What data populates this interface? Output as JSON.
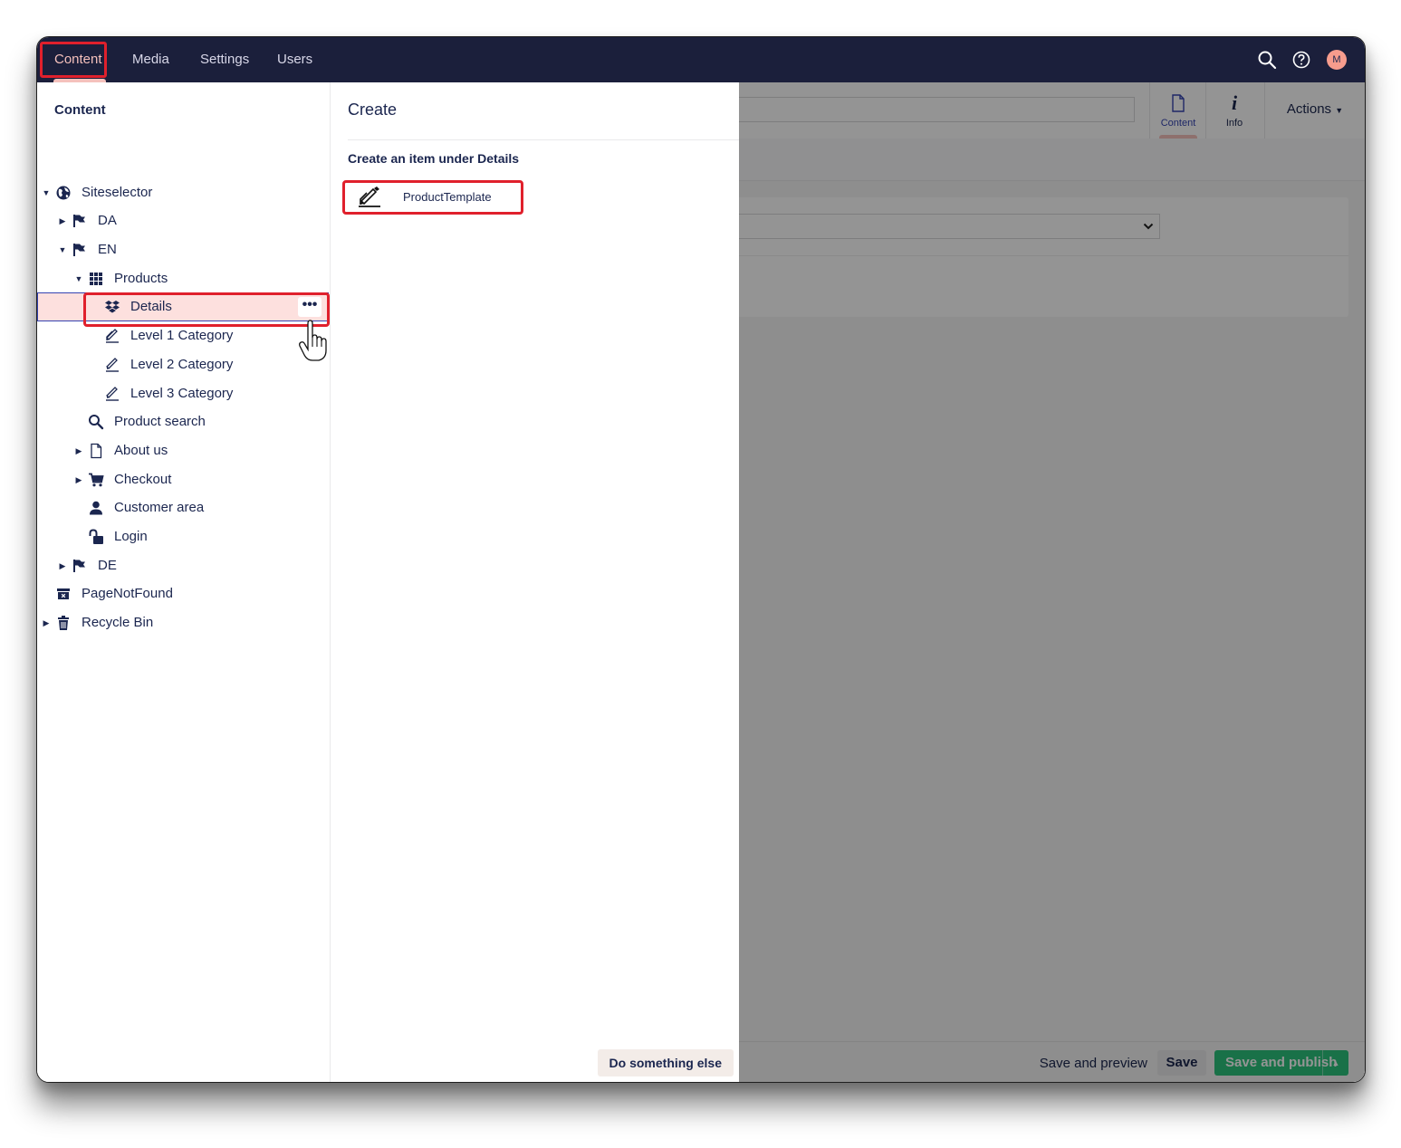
{
  "topnav": {
    "items": [
      {
        "label": "Content",
        "active": true
      },
      {
        "label": "Media"
      },
      {
        "label": "Settings"
      },
      {
        "label": "Users"
      }
    ],
    "avatar_initial": "M",
    "active_color": "#f5c1bc",
    "bar_color": "#1b1f3b"
  },
  "tree": {
    "header": "Content",
    "nodes": [
      {
        "label": "Siteselector",
        "icon": "globe-icon",
        "caret": "down"
      },
      {
        "label": "DA",
        "icon": "flag-icon",
        "caret": "right"
      },
      {
        "label": "EN",
        "icon": "flag-icon",
        "caret": "down"
      },
      {
        "label": "Products",
        "icon": "grid-icon",
        "caret": "down"
      },
      {
        "label": "Details",
        "icon": "dropbox-icon",
        "selected": true
      },
      {
        "label": "Level 1 Category",
        "icon": "edit-icon"
      },
      {
        "label": "Level 2 Category",
        "icon": "edit-icon"
      },
      {
        "label": "Level 3 Category",
        "icon": "edit-icon"
      },
      {
        "label": "Product search",
        "icon": "search-icon"
      },
      {
        "label": "About us",
        "icon": "document-icon",
        "caret": "right"
      },
      {
        "label": "Checkout",
        "icon": "cart-icon",
        "caret": "right"
      },
      {
        "label": "Customer area",
        "icon": "user-icon"
      },
      {
        "label": "Login",
        "icon": "unlock-icon"
      },
      {
        "label": "DE",
        "icon": "flag-icon",
        "caret": "right"
      },
      {
        "label": "PageNotFound",
        "icon": "archive-icon"
      },
      {
        "label": "Recycle Bin",
        "icon": "trash-icon",
        "caret": "right"
      }
    ],
    "more_label": "•••"
  },
  "create_dialog": {
    "title": "Create",
    "subtitle": "Create an item under Details",
    "items": [
      {
        "label": "ProductTemplate",
        "icon": "edit-icon"
      }
    ],
    "footer_button": "Do something else"
  },
  "editor": {
    "apps": [
      {
        "label": "Content",
        "icon": "document-icon",
        "active": true
      },
      {
        "label": "Info",
        "icon": "info-icon"
      }
    ],
    "actions_label": "Actions",
    "footer": {
      "save_and_preview": "Save and preview",
      "save": "Save",
      "save_and_publish": "Save and publish",
      "publish_color": "#2bc37c"
    }
  }
}
